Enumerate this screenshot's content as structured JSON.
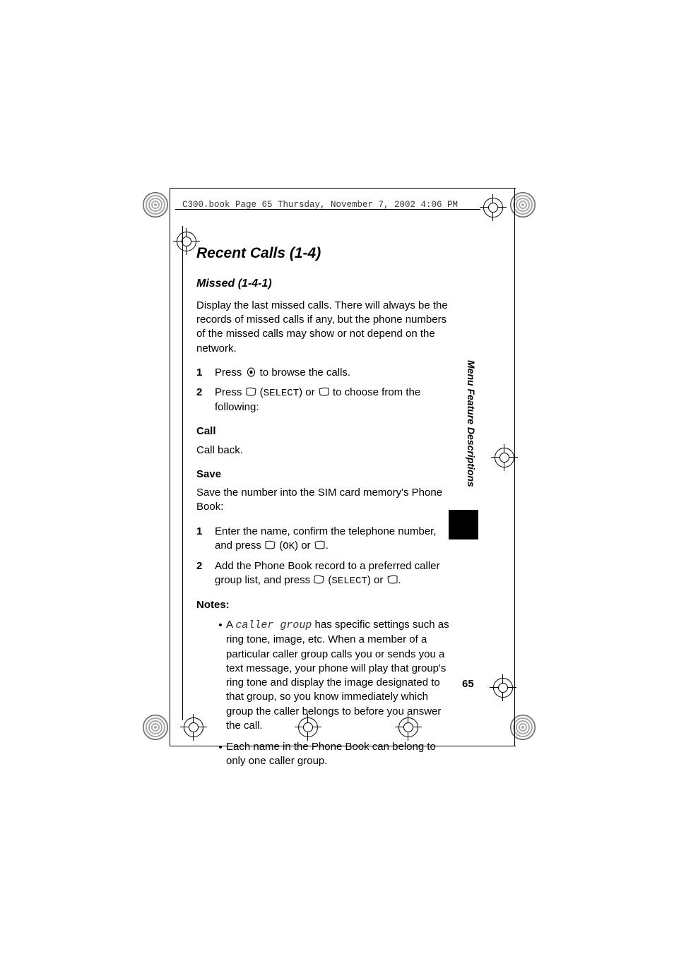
{
  "header": {
    "running": "C300.book  Page 65  Thursday, November 7, 2002  4:06 PM"
  },
  "headings": {
    "section": "Recent Calls (1-4)",
    "subsection": "Missed (1-4-1)"
  },
  "intro": "Display the last missed calls.  There will always be the records of missed calls if any, but the phone numbers of the missed calls may show or not depend on the network.",
  "steps_main": [
    {
      "num": "1",
      "pre": "Press ",
      "icon": "nav-icon",
      "post": " to browse the calls."
    },
    {
      "num": "2",
      "pre": "Press ",
      "icon": "left-soft-icon",
      "label": "SELECT",
      "post_label": ") or ",
      "icon2": "right-soft-icon",
      "tail": " to choose from the following:"
    }
  ],
  "call": {
    "heading": "Call",
    "body": "Call back."
  },
  "save": {
    "heading": "Save",
    "intro": "Save the number into the SIM card memory's Phone Book:",
    "steps": [
      {
        "num": "1",
        "pre": "Enter the name, confirm the telephone number, and press ",
        "icon": "left-soft-icon",
        "label": "OK",
        "post_label": ") or ",
        "icon2": "right-soft-icon",
        "tail": "."
      },
      {
        "num": "2",
        "pre": "Add the Phone Book record to a preferred caller group list, and press ",
        "icon": "left-soft-icon",
        "label": "SELECT",
        "post_label": ") or ",
        "icon2": "right-soft-icon",
        "tail": "."
      }
    ]
  },
  "notes": {
    "heading": "Notes:",
    "items": [
      {
        "pre": "A ",
        "em": "caller group",
        "post": " has specific settings such as ring tone, image, etc. When a member of a particular caller group calls you or sends you a text message, your phone will play that group's ring tone and display the image designated to that group, so you know immediately which group the caller belongs to before you answer the call."
      },
      {
        "text": "Each name in the Phone Book can belong to only one caller group."
      }
    ]
  },
  "side_tab": "Menu Feature Descriptions",
  "page_number": "65"
}
